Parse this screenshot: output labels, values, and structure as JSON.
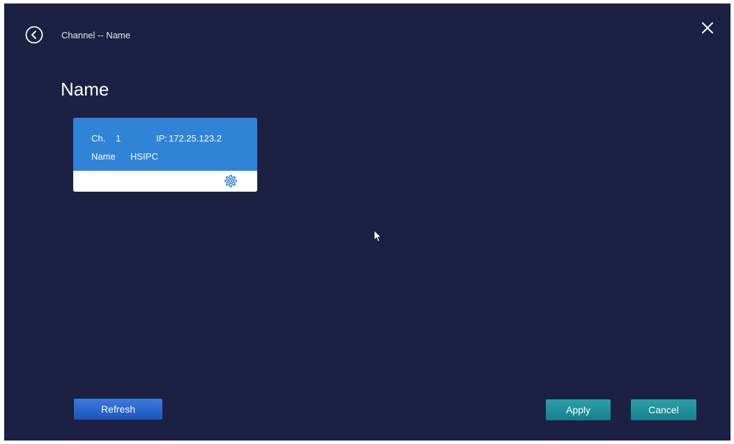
{
  "header": {
    "breadcrumb": "Channel -- Name",
    "back_icon": "back-circle-icon",
    "close_icon": "close-icon"
  },
  "page": {
    "title": "Name"
  },
  "channel_card": {
    "ch_label": "Ch.",
    "ch_value": "1",
    "ip_label": "IP:",
    "ip_value": "172.25.123.2",
    "name_label": "Name",
    "name_value": "HSIPC",
    "settings_icon": "gear-icon",
    "accent_color": "#2f84d8"
  },
  "footer": {
    "refresh_label": "Refresh",
    "apply_label": "Apply",
    "cancel_label": "Cancel"
  },
  "colors": {
    "background": "#1c2143",
    "primary_button": "#2563c9",
    "teal_button": "#1d8f9a"
  }
}
